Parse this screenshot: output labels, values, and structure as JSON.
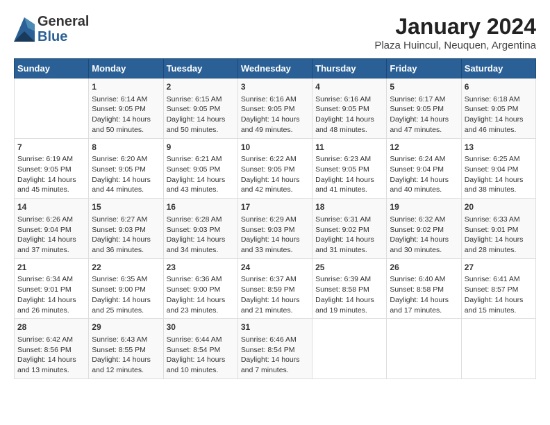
{
  "logo": {
    "general": "General",
    "blue": "Blue"
  },
  "title": "January 2024",
  "subtitle": "Plaza Huincul, Neuquen, Argentina",
  "days_of_week": [
    "Sunday",
    "Monday",
    "Tuesday",
    "Wednesday",
    "Thursday",
    "Friday",
    "Saturday"
  ],
  "weeks": [
    [
      {
        "day": "",
        "content": ""
      },
      {
        "day": "1",
        "content": "Sunrise: 6:14 AM\nSunset: 9:05 PM\nDaylight: 14 hours\nand 50 minutes."
      },
      {
        "day": "2",
        "content": "Sunrise: 6:15 AM\nSunset: 9:05 PM\nDaylight: 14 hours\nand 50 minutes."
      },
      {
        "day": "3",
        "content": "Sunrise: 6:16 AM\nSunset: 9:05 PM\nDaylight: 14 hours\nand 49 minutes."
      },
      {
        "day": "4",
        "content": "Sunrise: 6:16 AM\nSunset: 9:05 PM\nDaylight: 14 hours\nand 48 minutes."
      },
      {
        "day": "5",
        "content": "Sunrise: 6:17 AM\nSunset: 9:05 PM\nDaylight: 14 hours\nand 47 minutes."
      },
      {
        "day": "6",
        "content": "Sunrise: 6:18 AM\nSunset: 9:05 PM\nDaylight: 14 hours\nand 46 minutes."
      }
    ],
    [
      {
        "day": "7",
        "content": "Sunrise: 6:19 AM\nSunset: 9:05 PM\nDaylight: 14 hours\nand 45 minutes."
      },
      {
        "day": "8",
        "content": "Sunrise: 6:20 AM\nSunset: 9:05 PM\nDaylight: 14 hours\nand 44 minutes."
      },
      {
        "day": "9",
        "content": "Sunrise: 6:21 AM\nSunset: 9:05 PM\nDaylight: 14 hours\nand 43 minutes."
      },
      {
        "day": "10",
        "content": "Sunrise: 6:22 AM\nSunset: 9:05 PM\nDaylight: 14 hours\nand 42 minutes."
      },
      {
        "day": "11",
        "content": "Sunrise: 6:23 AM\nSunset: 9:05 PM\nDaylight: 14 hours\nand 41 minutes."
      },
      {
        "day": "12",
        "content": "Sunrise: 6:24 AM\nSunset: 9:04 PM\nDaylight: 14 hours\nand 40 minutes."
      },
      {
        "day": "13",
        "content": "Sunrise: 6:25 AM\nSunset: 9:04 PM\nDaylight: 14 hours\nand 38 minutes."
      }
    ],
    [
      {
        "day": "14",
        "content": "Sunrise: 6:26 AM\nSunset: 9:04 PM\nDaylight: 14 hours\nand 37 minutes."
      },
      {
        "day": "15",
        "content": "Sunrise: 6:27 AM\nSunset: 9:03 PM\nDaylight: 14 hours\nand 36 minutes."
      },
      {
        "day": "16",
        "content": "Sunrise: 6:28 AM\nSunset: 9:03 PM\nDaylight: 14 hours\nand 34 minutes."
      },
      {
        "day": "17",
        "content": "Sunrise: 6:29 AM\nSunset: 9:03 PM\nDaylight: 14 hours\nand 33 minutes."
      },
      {
        "day": "18",
        "content": "Sunrise: 6:31 AM\nSunset: 9:02 PM\nDaylight: 14 hours\nand 31 minutes."
      },
      {
        "day": "19",
        "content": "Sunrise: 6:32 AM\nSunset: 9:02 PM\nDaylight: 14 hours\nand 30 minutes."
      },
      {
        "day": "20",
        "content": "Sunrise: 6:33 AM\nSunset: 9:01 PM\nDaylight: 14 hours\nand 28 minutes."
      }
    ],
    [
      {
        "day": "21",
        "content": "Sunrise: 6:34 AM\nSunset: 9:01 PM\nDaylight: 14 hours\nand 26 minutes."
      },
      {
        "day": "22",
        "content": "Sunrise: 6:35 AM\nSunset: 9:00 PM\nDaylight: 14 hours\nand 25 minutes."
      },
      {
        "day": "23",
        "content": "Sunrise: 6:36 AM\nSunset: 9:00 PM\nDaylight: 14 hours\nand 23 minutes."
      },
      {
        "day": "24",
        "content": "Sunrise: 6:37 AM\nSunset: 8:59 PM\nDaylight: 14 hours\nand 21 minutes."
      },
      {
        "day": "25",
        "content": "Sunrise: 6:39 AM\nSunset: 8:58 PM\nDaylight: 14 hours\nand 19 minutes."
      },
      {
        "day": "26",
        "content": "Sunrise: 6:40 AM\nSunset: 8:58 PM\nDaylight: 14 hours\nand 17 minutes."
      },
      {
        "day": "27",
        "content": "Sunrise: 6:41 AM\nSunset: 8:57 PM\nDaylight: 14 hours\nand 15 minutes."
      }
    ],
    [
      {
        "day": "28",
        "content": "Sunrise: 6:42 AM\nSunset: 8:56 PM\nDaylight: 14 hours\nand 13 minutes."
      },
      {
        "day": "29",
        "content": "Sunrise: 6:43 AM\nSunset: 8:55 PM\nDaylight: 14 hours\nand 12 minutes."
      },
      {
        "day": "30",
        "content": "Sunrise: 6:44 AM\nSunset: 8:54 PM\nDaylight: 14 hours\nand 10 minutes."
      },
      {
        "day": "31",
        "content": "Sunrise: 6:46 AM\nSunset: 8:54 PM\nDaylight: 14 hours\nand 7 minutes."
      },
      {
        "day": "",
        "content": ""
      },
      {
        "day": "",
        "content": ""
      },
      {
        "day": "",
        "content": ""
      }
    ]
  ]
}
